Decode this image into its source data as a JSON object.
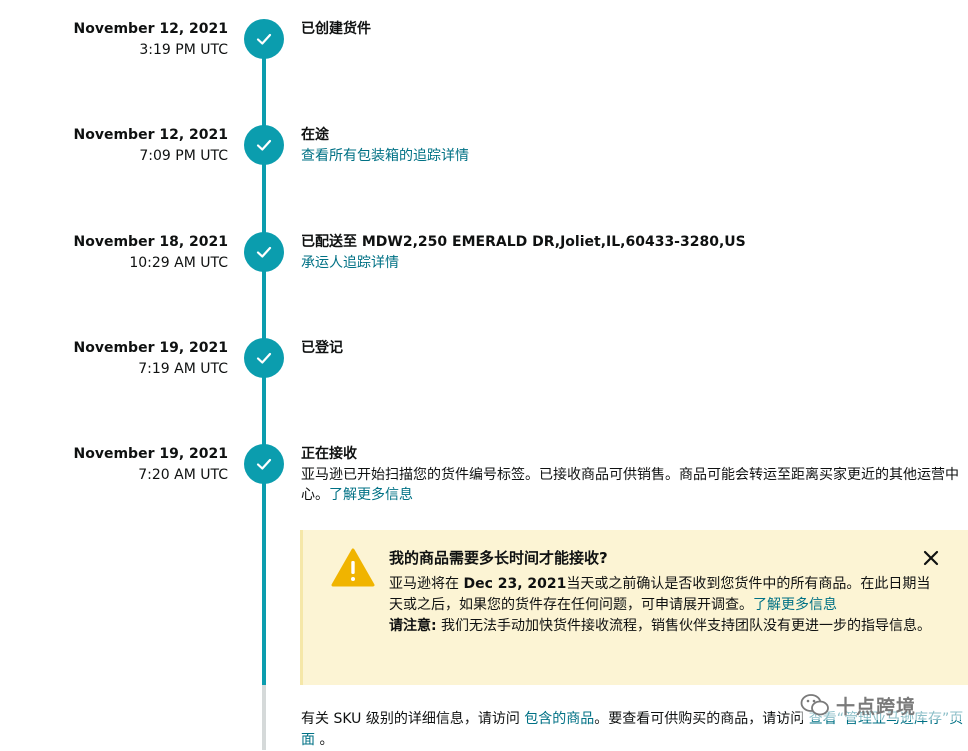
{
  "events": [
    {
      "date": "November 12, 2021",
      "time": "3:19 PM UTC",
      "title": "已创建货件",
      "link": ""
    },
    {
      "date": "November 12, 2021",
      "time": "7:09 PM UTC",
      "title": "在途",
      "link": "查看所有包装箱的追踪详情"
    },
    {
      "date": "November 18, 2021",
      "time": "10:29 AM UTC",
      "title": "已配送至 MDW2,250 EMERALD DR,Joliet,IL,60433-3280,US",
      "link": "承运人追踪详情"
    },
    {
      "date": "November 19, 2021",
      "time": "7:19 AM UTC",
      "title": "已登记",
      "link": ""
    },
    {
      "date": "November 19, 2021",
      "time": "7:20 AM UTC",
      "title": "正在接收",
      "desc": "亚马逊已开始扫描您的货件编号标签。已接收商品可供销售。商品可能会转运至距离买家更近的其他运营中心。",
      "desc_link": "了解更多信息"
    }
  ],
  "alert": {
    "title": "我的商品需要多长时间才能接收?",
    "body_part1": "亚马逊将在 ",
    "body_date": "Dec 23, 2021",
    "body_part2": "当天或之前确认是否收到您货件中的所有商品。在此日期当天或之后，如果您的货件存在任何问题，可申请展开调查。",
    "body_link": "了解更多信息",
    "note_label": "请注意:",
    "note_text": " 我们无法手动加快货件接收流程，销售伙伴支持团队没有更进一步的指导信息。"
  },
  "footer": {
    "part1": "有关 SKU 级别的详细信息，请访问 ",
    "link1": "包含的商品",
    "part2": "。要查看可供购买的商品，请访问 ",
    "link2": "查看“管理亚马逊库存”页面",
    "part3": " 。"
  },
  "watermark": {
    "text": "十点跨境",
    "icon": "wechat-icon"
  },
  "colors": {
    "accent": "#0b9dae",
    "link": "#007185",
    "alert_bg": "#fcf4d4",
    "warning": "#f0b400"
  }
}
